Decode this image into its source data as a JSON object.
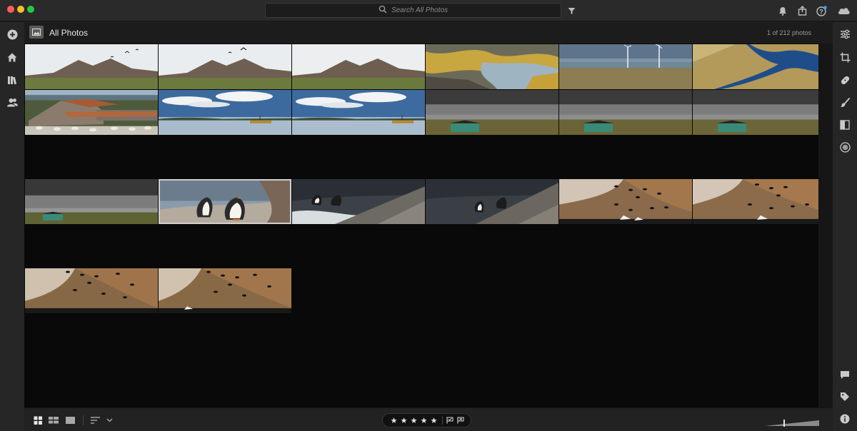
{
  "window": {
    "traffic_colors": [
      "#ff5f57",
      "#febc2e",
      "#28c840"
    ]
  },
  "toolbar": {
    "search_placeholder": "Search All Photos",
    "icons": [
      "search-icon",
      "filter-icon",
      "bell-icon",
      "share-icon",
      "help-icon",
      "cloud-icon"
    ],
    "help_badge_color": "#3aa0ff"
  },
  "left_rail": {
    "items": [
      "add-photo-icon",
      "home-icon",
      "library-icon",
      "people-icon"
    ]
  },
  "header": {
    "title": "All Photos",
    "count": "1 of 212 photos"
  },
  "grid": {
    "photos": [
      {
        "scene": "mountain-birds"
      },
      {
        "scene": "mountain-birds"
      },
      {
        "scene": "mountain"
      },
      {
        "scene": "rocky-shore"
      },
      {
        "scene": "wind-turbines"
      },
      {
        "scene": "river-aerial"
      },
      {
        "scene": "barn-sheep"
      },
      {
        "scene": "bay-boat"
      },
      {
        "scene": "bay-boat"
      },
      {
        "scene": "green-shed"
      },
      {
        "scene": "green-shed"
      },
      {
        "scene": "green-shed"
      },
      {
        "scene": "green-shed-wide"
      },
      {
        "scene": "gentoo-penguins",
        "selected": true
      },
      {
        "scene": "penguins-rock-wave"
      },
      {
        "scene": "penguins-rock-wave-2"
      },
      {
        "scene": "rockhopper-cliff"
      },
      {
        "scene": "rockhopper-cliff"
      },
      {
        "scene": "rockhopper-cliff"
      },
      {
        "scene": "rockhopper-cliff"
      }
    ]
  },
  "right_rail": {
    "items": [
      "edit-sliders-icon",
      "crop-icon",
      "healing-icon",
      "brush-icon",
      "gradient-icon",
      "radial-icon",
      "comment-icon",
      "tag-icon",
      "info-icon"
    ]
  },
  "bottom_bar": {
    "view_icons": [
      "square-grid-icon",
      "photo-grid-icon",
      "detail-view-icon",
      "sort-icon",
      "chevron-down-icon"
    ],
    "rating_stars": [
      "★",
      "★",
      "★",
      "★",
      "★"
    ],
    "flag_icons": [
      "flag-pick-icon",
      "flag-reject-icon"
    ]
  }
}
